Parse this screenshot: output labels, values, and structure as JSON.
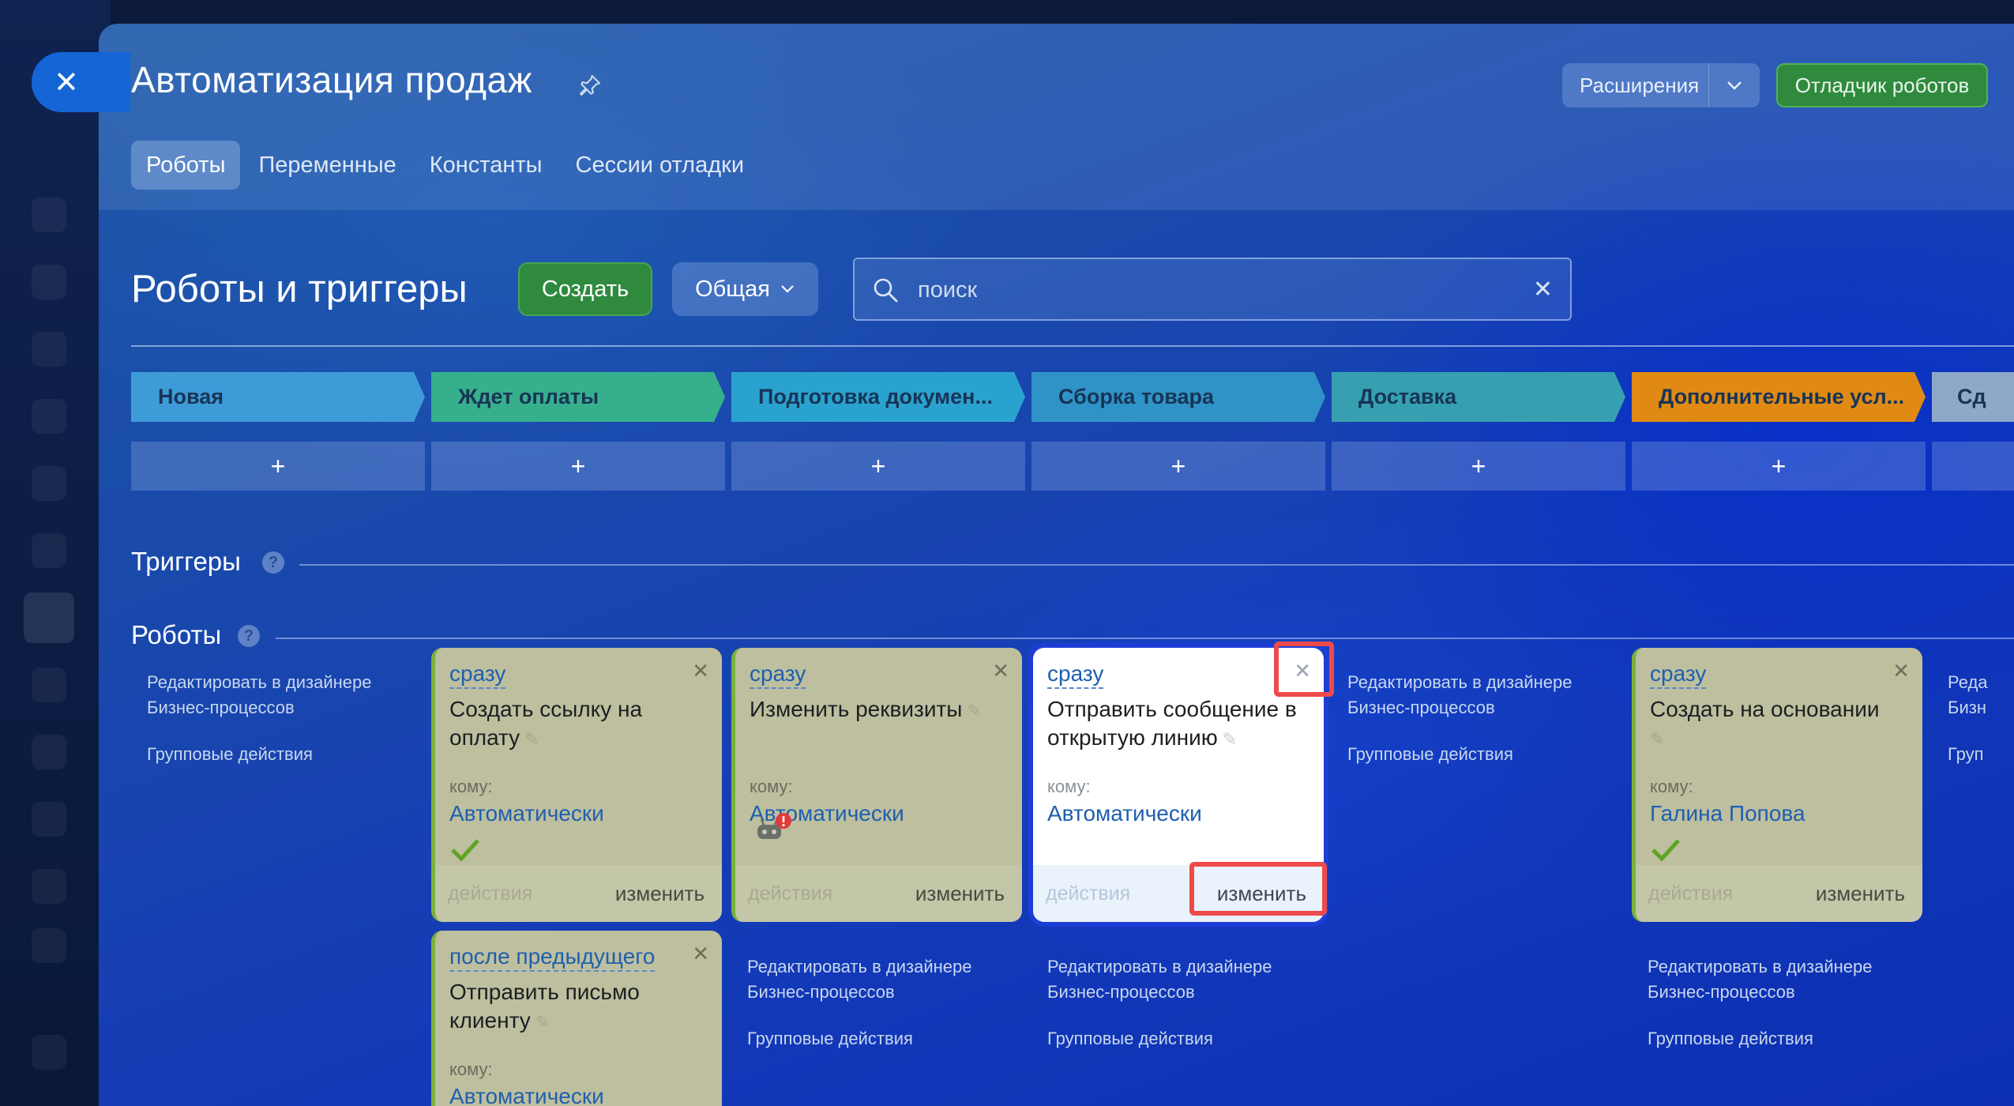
{
  "window": {
    "title": "Автоматизация продаж",
    "extensions_label": "Расширения",
    "debugger_label": "Отладчик роботов",
    "tabs": [
      "Роботы",
      "Переменные",
      "Константы",
      "Сессии отладки"
    ]
  },
  "toolbar": {
    "section_title": "Роботы и триггеры",
    "create_label": "Создать",
    "general_label": "Общая",
    "search_placeholder": "поиск"
  },
  "stages": [
    {
      "name": "Новая",
      "color": "#3e9bd8"
    },
    {
      "name": "Ждет оплаты",
      "color": "#36b08c"
    },
    {
      "name": "Подготовка докумен...",
      "color": "#2aa2cf"
    },
    {
      "name": "Сборка товара",
      "color": "#2f93c8"
    },
    {
      "name": "Доставка",
      "color": "#36a0b0"
    },
    {
      "name": "Дополнительные усл...",
      "color": "#e08a14"
    },
    {
      "name": "Сд",
      "color": "#8fa8c8"
    }
  ],
  "add_symbol": "+",
  "rows": {
    "triggers_label": "Триггеры",
    "robots_label": "Роботы",
    "help_symbol": "?"
  },
  "side_links": {
    "designer": "Редактировать в дизайнере Бизнес-процессов",
    "group": "Групповые действия"
  },
  "side_partial": {
    "designer_1": "Реда",
    "designer_2": "Бизн",
    "group": "Груп"
  },
  "cards": [
    {
      "when": "сразу",
      "name": "Создать ссылку на оплату",
      "to_label": "кому:",
      "who": "Автоматически",
      "status": "done",
      "actions": "действия",
      "edit": "изменить"
    },
    {
      "when": "сразу",
      "name": "Изменить реквизиты",
      "to_label": "кому:",
      "who": "Автоматически",
      "status": "error",
      "actions": "действия",
      "edit": "изменить"
    },
    {
      "when": "сразу",
      "name": "Отправить сообщение в открытую линию",
      "to_label": "кому:",
      "who": "Автоматически",
      "status": "none",
      "actions": "действия",
      "edit": "изменить"
    },
    {
      "when": "сразу",
      "name": "Создать на основании",
      "to_label": "кому:",
      "who": "Галина Попова",
      "status": "done",
      "actions": "действия",
      "edit": "изменить"
    },
    {
      "when": "после предыдущего",
      "name": "Отправить письмо клиенту",
      "to_label": "кому:",
      "who": "Автоматически",
      "status": "none"
    }
  ],
  "colors": {
    "accent_green": "#2f8a3e",
    "link_blue": "#1e5fb0",
    "highlight_red": "#ef4a4a",
    "selected_border": "#1d3ed6"
  }
}
